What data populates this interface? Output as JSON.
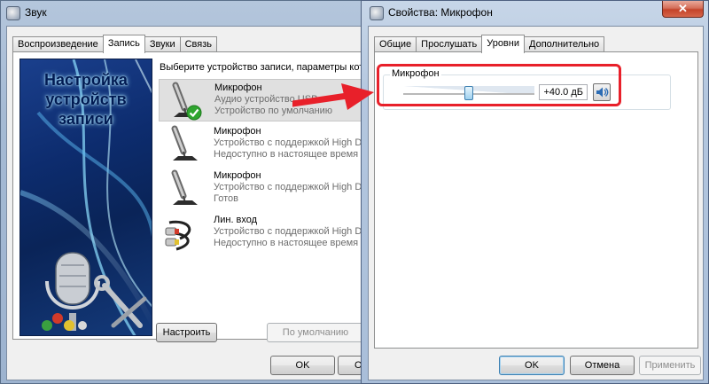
{
  "sound_window": {
    "title": "Звук",
    "tabs": [
      {
        "label": "Воспроизведение",
        "active": false
      },
      {
        "label": "Запись",
        "active": true
      },
      {
        "label": "Звуки",
        "active": false
      },
      {
        "label": "Связь",
        "active": false
      }
    ],
    "art_title": "Настройка устройств записи",
    "instruction": "Выберите устройство записи, параметры котор",
    "devices": [
      {
        "name": "Микрофон",
        "line1": "Аудио устройство USB",
        "line2": "Устройство по умолчанию",
        "icon": "microphone-icon",
        "selected": true,
        "default_check": true
      },
      {
        "name": "Микрофон",
        "line1": "Устройство с поддержкой High Defi",
        "line2": "Недоступно в настоящее время",
        "icon": "microphone-icon",
        "selected": false,
        "default_check": false
      },
      {
        "name": "Микрофон",
        "line1": "Устройство с поддержкой High Defi",
        "line2": "Готов",
        "icon": "microphone-icon",
        "selected": false,
        "default_check": false
      },
      {
        "name": "Лин. вход",
        "line1": "Устройство с поддержкой High Defi",
        "line2": "Недоступно в настоящее время",
        "icon": "line-in-cable-icon",
        "selected": false,
        "default_check": false
      }
    ],
    "configure_button": "Настроить",
    "default_button": "По умолчанию",
    "ok_button": "OK",
    "cancel_button_partial": "О"
  },
  "props_window": {
    "title": "Свойства: Микрофон",
    "tabs": [
      {
        "label": "Общие",
        "active": false
      },
      {
        "label": "Прослушать",
        "active": false
      },
      {
        "label": "Уровни",
        "active": true
      },
      {
        "label": "Дополнительно",
        "active": false
      }
    ],
    "group_label": "Микрофон",
    "level_value": "+40.0 дБ",
    "slider_level_fraction": 0.5,
    "ok_button": "OK",
    "cancel_button": "Отмена",
    "apply_button": "Применить",
    "close_glyph": "✕"
  },
  "colors": {
    "highlight": "#e8202a",
    "default_check": "#2fa52f"
  }
}
